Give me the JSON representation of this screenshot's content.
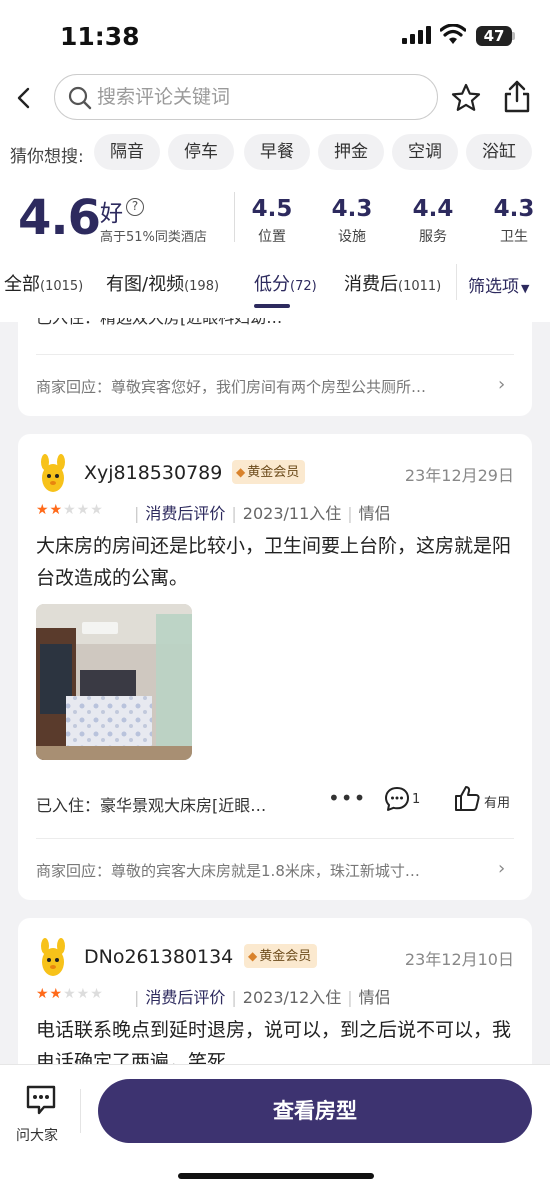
{
  "status_bar": {
    "time": "11:38",
    "battery": "47"
  },
  "search": {
    "placeholder": "搜索评论关键词"
  },
  "guess": {
    "label": "猜你想搜:",
    "chips": [
      "隔音",
      "停车",
      "早餐",
      "押金",
      "空调",
      "浴缸"
    ]
  },
  "rating": {
    "overall": "4.6",
    "word": "好",
    "compare": "高于51%同类酒店",
    "subs": [
      {
        "value": "4.5",
        "name": "位置"
      },
      {
        "value": "4.3",
        "name": "设施"
      },
      {
        "value": "4.4",
        "name": "服务"
      },
      {
        "value": "4.3",
        "name": "卫生"
      }
    ]
  },
  "tabs": [
    {
      "label": "全部",
      "count": "(1015)"
    },
    {
      "label": "有图/视频",
      "count": "(198)"
    },
    {
      "label": "低分",
      "count": "(72)"
    },
    {
      "label": "消费后",
      "count": "(1011)"
    }
  ],
  "active_tab": "低分",
  "filter": {
    "label": "筛选项"
  },
  "reviews": [
    {
      "partial_text": "已入住：精选双大房[近眼科妇幼…",
      "merchant_reply": "商家回应：尊敬宾客您好，我们房间有两个房型公共厕所…"
    },
    {
      "user": "Xyj818530789",
      "badge": "黄金会员",
      "date": "23年12月29日",
      "rating": 2,
      "tag": "消费后评价",
      "stay_month": "2023/11入住",
      "trip_type": "情侣",
      "text": "大床房的房间还是比较小，卫生间要上台阶，这房就是阳台改造成的公寓。",
      "stayed": "已入住：豪华景观大床房[近眼…",
      "comments": "1",
      "useful": "有用",
      "merchant_reply": "商家回应：尊敬的宾客大床房就是1.8米床，珠江新城寸…"
    },
    {
      "user": "DNo261380134",
      "badge": "黄金会员",
      "date": "23年12月10日",
      "rating": 2,
      "tag": "消费后评价",
      "stay_month": "2023/12入住",
      "trip_type": "情侣",
      "text": "电话联系晚点到延时退房，说可以，到之后说不可以，我电话确定了两遍，笑死"
    }
  ],
  "bottom": {
    "ask_label": "问大家",
    "cta": "查看房型"
  },
  "colors": {
    "accent": "#2d2a5e",
    "cta": "#3d3370",
    "star": "#ff6a1a",
    "badge_bg": "#fbe9cf"
  }
}
